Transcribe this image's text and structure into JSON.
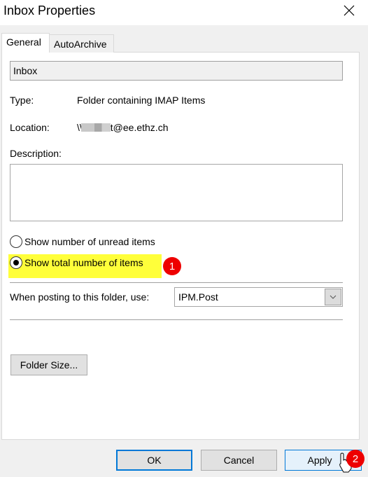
{
  "window": {
    "title": "Inbox Properties",
    "close_icon": "close-icon"
  },
  "tabs": [
    {
      "label": "General",
      "active": true
    },
    {
      "label": "AutoArchive",
      "active": false
    }
  ],
  "general": {
    "folder_name": "Inbox",
    "type_label": "Type:",
    "type_value": "Folder containing IMAP Items",
    "location_label": "Location:",
    "location_prefix": "\\\\",
    "location_suffix": "t@ee.ethz.ch",
    "description_label": "Description:",
    "description_value": "",
    "radio_unread": {
      "label": "Show number of unread items",
      "checked": false
    },
    "radio_total": {
      "label": "Show total number of items",
      "checked": true
    },
    "posting_label": "When posting to this folder, use:",
    "posting_value": "IPM.Post",
    "folder_size_button": "Folder Size..."
  },
  "annotations": {
    "badge1": "1",
    "badge2": "2",
    "highlight_color": "#ffff3a",
    "badge_color": "#e00000"
  },
  "footer": {
    "ok": "OK",
    "cancel": "Cancel",
    "apply": "Apply"
  }
}
